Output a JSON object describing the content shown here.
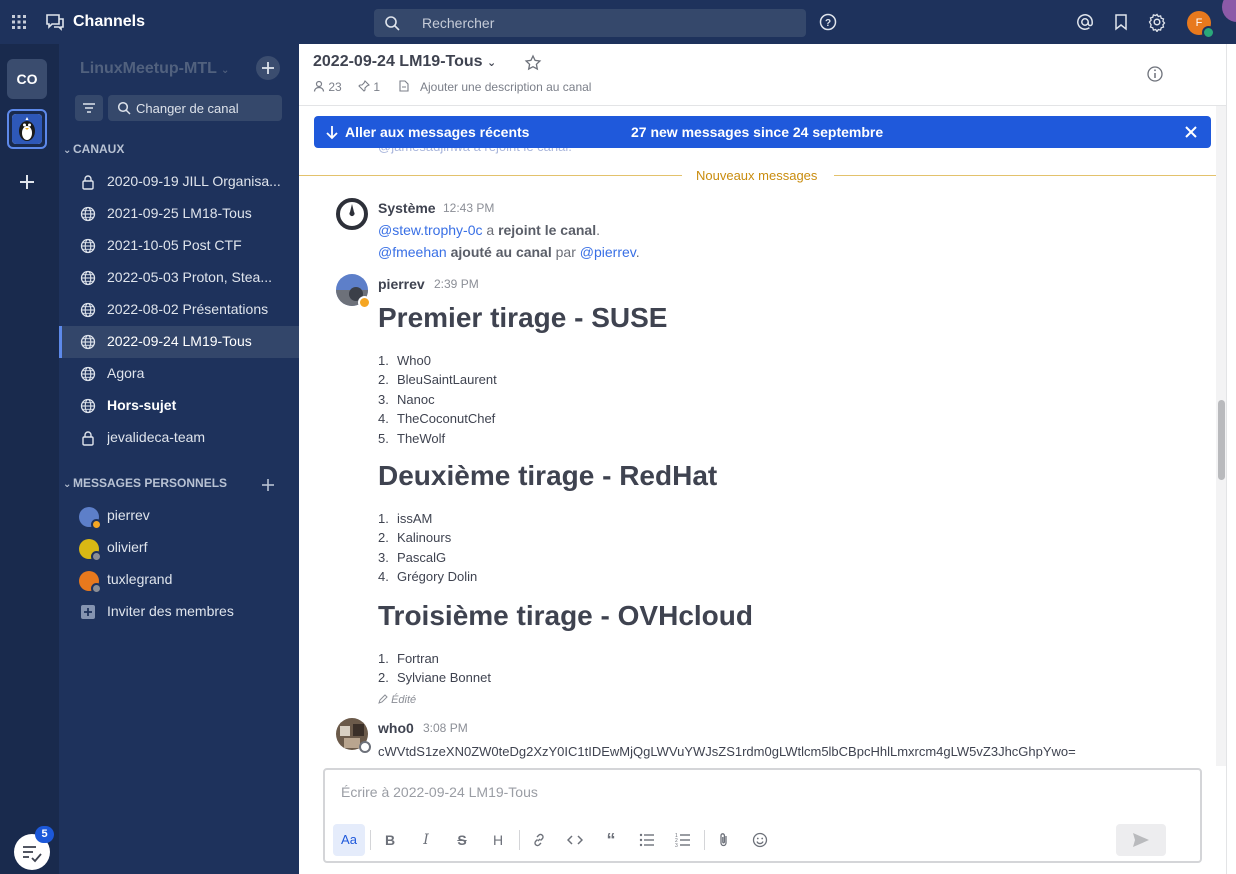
{
  "app": {
    "product_name": "Channels"
  },
  "search": {
    "placeholder": "Rechercher"
  },
  "user": {
    "initial": "F",
    "status_color": "#2aa87a"
  },
  "teams": {
    "current_initials": "CO",
    "drafts_count": "5"
  },
  "sidebar": {
    "team_name": "LinuxMeetup-MTL",
    "switcher_label": "Changer de canal",
    "channels_header": "CANAUX",
    "channels": [
      {
        "name": "2020-09-19 JILL Organisa...",
        "icon": "lock-icon"
      },
      {
        "name": "2021-09-25 LM18-Tous",
        "icon": "globe-icon"
      },
      {
        "name": "2021-10-05 Post CTF",
        "icon": "globe-icon"
      },
      {
        "name": "2022-05-03 Proton, Stea...",
        "icon": "globe-icon"
      },
      {
        "name": "2022-08-02 Présentations",
        "icon": "globe-icon"
      },
      {
        "name": "2022-09-24 LM19-Tous",
        "icon": "globe-icon",
        "active": true
      },
      {
        "name": "Agora",
        "icon": "globe-icon"
      },
      {
        "name": "Hors-sujet",
        "icon": "globe-icon",
        "unread": true
      },
      {
        "name": "jevalideca-team",
        "icon": "lock-icon"
      }
    ],
    "dm_header": "MESSAGES PERSONNELS",
    "dms": [
      {
        "name": "pierrev",
        "avatar_color": "#5d7fc9",
        "status_color": "#f5a623"
      },
      {
        "name": "olivierf",
        "avatar_color": "#d9b814",
        "status_color": "#8b8e96"
      },
      {
        "name": "tuxlegrand",
        "avatar_color": "#e8791d",
        "status_color": "#8b8e96"
      }
    ],
    "invite_label": "Inviter des membres"
  },
  "channel": {
    "title": "2022-09-24 LM19-Tous",
    "members": "23",
    "pinned": "1",
    "description_placeholder": "Ajouter une description au canal"
  },
  "toast": {
    "jump_label": "Aller aux messages récents",
    "new_count_label": "27 new messages since 24 septembre"
  },
  "messages": {
    "faded_prev": "@jamesadjinwa a rejoint le canal.",
    "new_separator": "Nouveaux messages",
    "system_post": {
      "author": "Système",
      "time": "12:43 PM",
      "line1_mention": "@stew.trophy-0c",
      "line1_mid": " a ",
      "line1_action": "rejoint le canal",
      "line1_end": ".",
      "line2_mention": "@fmeehan",
      "line2_action": " ajouté au canal",
      "line2_mid": " par ",
      "line2_actor": "@pierrev",
      "line2_end": "."
    },
    "pierrev_post": {
      "author": "pierrev",
      "time": "2:39 PM",
      "sections": [
        {
          "heading": "Premier tirage - SUSE",
          "items": [
            "Who0",
            "BleuSaintLaurent",
            "Nanoc",
            "TheCoconutChef",
            "TheWolf"
          ]
        },
        {
          "heading": "Deuxième tirage - RedHat",
          "items": [
            "issAM",
            "Kalinours",
            "PascalG",
            "Grégory Dolin"
          ]
        },
        {
          "heading": "Troisième tirage - OVHcloud",
          "items": [
            "Fortran",
            "Sylviane Bonnet"
          ]
        }
      ],
      "edited_label": "Édité"
    },
    "who0_post": {
      "author": "who0",
      "time": "3:08 PM",
      "text": "cWVtdS1zeXN0ZW0teDg2XzY0IC1tIDEwMjQgLWVuYWJsZS1rdm0gLWtlcm5lbCBpcHhlLmxrcm4gLW5vZ3JhcGhpYwo="
    }
  },
  "composer": {
    "placeholder": "Écrire à 2022-09-24 LM19-Tous",
    "aa_label": "Aa"
  }
}
